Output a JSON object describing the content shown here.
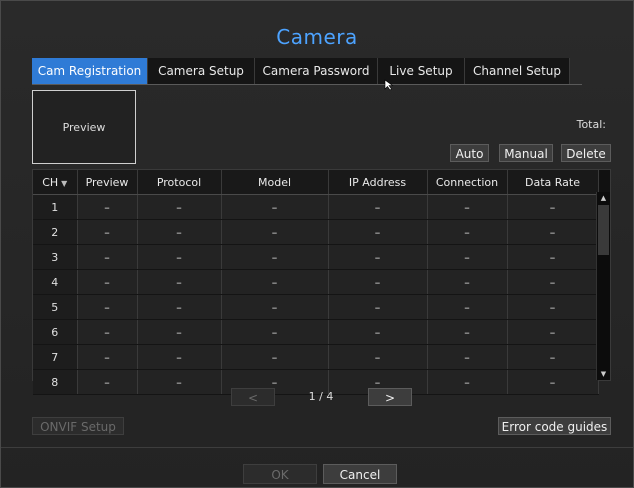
{
  "dialog": {
    "title": "Camera",
    "tabs": [
      {
        "label": "Cam Registration",
        "active": true
      },
      {
        "label": "Camera Setup",
        "active": false
      },
      {
        "label": "Camera Password",
        "active": false
      },
      {
        "label": "Live Setup",
        "active": false
      },
      {
        "label": "Channel Setup",
        "active": false
      }
    ],
    "preview_label": "Preview",
    "total_label": "Total:",
    "buttons": {
      "auto": "Auto",
      "manual": "Manual",
      "delete": "Delete"
    },
    "table": {
      "columns": [
        "CH",
        "Preview",
        "Protocol",
        "Model",
        "IP Address",
        "Connection",
        "Data Rate"
      ],
      "rows": [
        [
          "1",
          "–",
          "–",
          "–",
          "–",
          "–",
          "–"
        ],
        [
          "2",
          "–",
          "–",
          "–",
          "–",
          "–",
          "–"
        ],
        [
          "3",
          "–",
          "–",
          "–",
          "–",
          "–",
          "–"
        ],
        [
          "4",
          "–",
          "–",
          "–",
          "–",
          "–",
          "–"
        ],
        [
          "5",
          "–",
          "–",
          "–",
          "–",
          "–",
          "–"
        ],
        [
          "6",
          "–",
          "–",
          "–",
          "–",
          "–",
          "–"
        ],
        [
          "7",
          "–",
          "–",
          "–",
          "–",
          "–",
          "–"
        ],
        [
          "8",
          "–",
          "–",
          "–",
          "–",
          "–",
          "–"
        ]
      ]
    },
    "pager": {
      "prev": "<",
      "page": "1 / 4",
      "next": ">"
    },
    "onvif_label": "ONVIF Setup",
    "error_guides_label": "Error code guides",
    "ok_label": "OK",
    "cancel_label": "Cancel",
    "colors": {
      "accent": "#2f7bd6",
      "title": "#4da3ff"
    }
  }
}
